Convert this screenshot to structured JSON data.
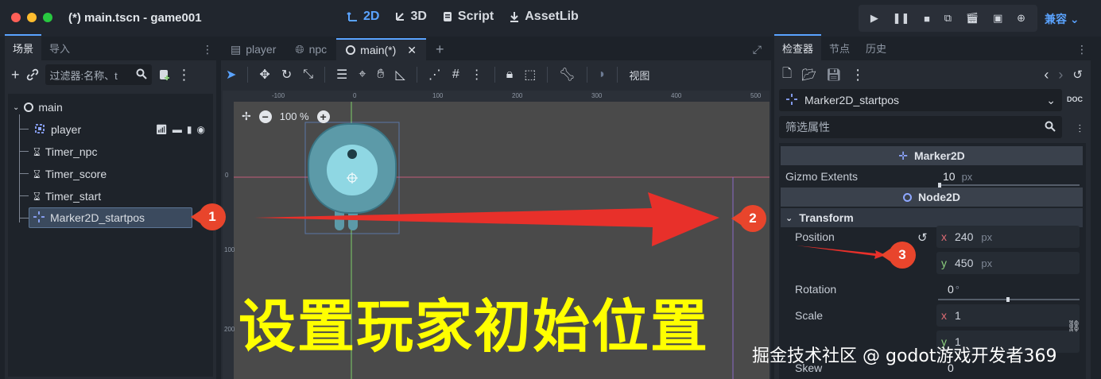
{
  "window": {
    "title": "(*) main.tscn - game001",
    "modes": [
      "2D",
      "3D",
      "Script",
      "AssetLib"
    ],
    "active_mode": "2D",
    "compat_label": "兼容"
  },
  "scene_dock": {
    "tabs": [
      "场景",
      "导入"
    ],
    "filter_placeholder": "过滤器:名称、t",
    "tree": [
      {
        "name": "main",
        "icon": "node2d-circle-icon",
        "depth": 0
      },
      {
        "name": "player",
        "icon": "area-node-icon",
        "depth": 1
      },
      {
        "name": "Timer_npc",
        "icon": "timer-icon",
        "depth": 1
      },
      {
        "name": "Timer_score",
        "icon": "timer-icon",
        "depth": 1
      },
      {
        "name": "Timer_start",
        "icon": "timer-icon",
        "depth": 1
      },
      {
        "name": "Marker2D_startpos",
        "icon": "marker2d-icon",
        "depth": 1,
        "selected": true
      }
    ]
  },
  "editor": {
    "tabs": [
      {
        "label": "player",
        "icon": "scene-icon"
      },
      {
        "label": "npc",
        "icon": "globe-icon"
      },
      {
        "label": "main(*)",
        "icon": "node2d-circle-icon",
        "active": true
      }
    ],
    "view_menu": "视图",
    "zoom": "100 %",
    "ruler_labels": [
      "-100",
      "0",
      "100",
      "200",
      "300",
      "400",
      "500"
    ],
    "ruler_v_labels": [
      "0",
      "100",
      "200"
    ],
    "overlay_text": "设置玩家初始位置"
  },
  "inspector": {
    "tabs": [
      "检查器",
      "节点",
      "历史"
    ],
    "node_name": "Marker2D_startpos",
    "filter_placeholder": "筛选属性",
    "sections": {
      "marker": "Marker2D",
      "node2d": "Node2D",
      "transform": "Transform"
    },
    "props": {
      "gizmo_label": "Gizmo Extents",
      "gizmo_value": "10",
      "gizmo_unit": "px",
      "position_label": "Position",
      "pos_x": "240",
      "pos_y": "450",
      "pos_unit": "px",
      "axis_x": "x",
      "axis_y": "y",
      "rotation_label": "Rotation",
      "rotation_value": "0",
      "rotation_unit": "°",
      "scale_label": "Scale",
      "scale_x": "1",
      "scale_y": "1",
      "skew_label": "Skew",
      "skew_value": "0"
    }
  },
  "badges": [
    "1",
    "2",
    "3"
  ],
  "watermark": "掘金技术社区 @ godot游戏开发者369",
  "colors": {
    "accent": "#5aa3ff",
    "arrow": "#e8302a",
    "overlay_text": "#ffff00",
    "badge": "#e8452c"
  }
}
